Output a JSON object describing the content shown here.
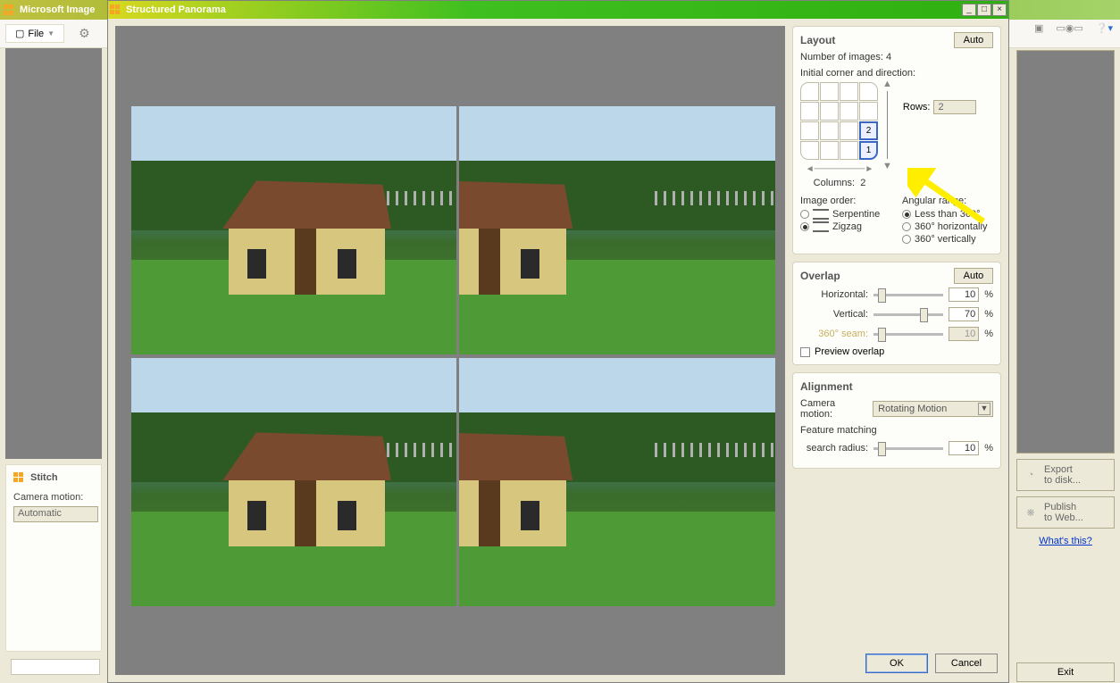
{
  "bg": {
    "title": "Microsoft Image",
    "file_label": "File",
    "stitch": {
      "header": "Stitch",
      "camera_motion_label": "Camera motion:",
      "camera_motion_value": "Automatic"
    },
    "export_label": "Export\nto disk...",
    "publish_label": "Publish\nto Web...",
    "whats_this": "What's this?",
    "exit_label": "Exit"
  },
  "dlg": {
    "title": "Structured Panorama",
    "ok": "OK",
    "cancel": "Cancel"
  },
  "layout": {
    "header": "Layout",
    "auto": "Auto",
    "num_images_label": "Number of images:",
    "num_images_value": "4",
    "initial_label": "Initial corner and direction:",
    "rows_label": "Rows:",
    "rows_value": "2",
    "columns_label": "Columns:",
    "columns_value": "2",
    "cell2": "2",
    "cell1": "1",
    "image_order_label": "Image order:",
    "order_options": [
      "Serpentine",
      "Zigzag"
    ],
    "order_selected": "Zigzag",
    "angular_label": "Angular range:",
    "angular_options": [
      "Less than 360°",
      "360° horizontally",
      "360° vertically"
    ],
    "angular_selected": "Less than 360°"
  },
  "overlap": {
    "header": "Overlap",
    "auto": "Auto",
    "horizontal_label": "Horizontal:",
    "horizontal_value": "10",
    "vertical_label": "Vertical:",
    "vertical_value": "70",
    "seam_label": "360° seam:",
    "seam_value": "10",
    "preview_label": "Preview overlap",
    "pct": "%"
  },
  "alignment": {
    "header": "Alignment",
    "camera_motion_label": "Camera motion:",
    "camera_motion_value": "Rotating Motion",
    "feature_label": "Feature matching",
    "search_radius_label": "search radius:",
    "search_radius_value": "10",
    "pct": "%"
  }
}
